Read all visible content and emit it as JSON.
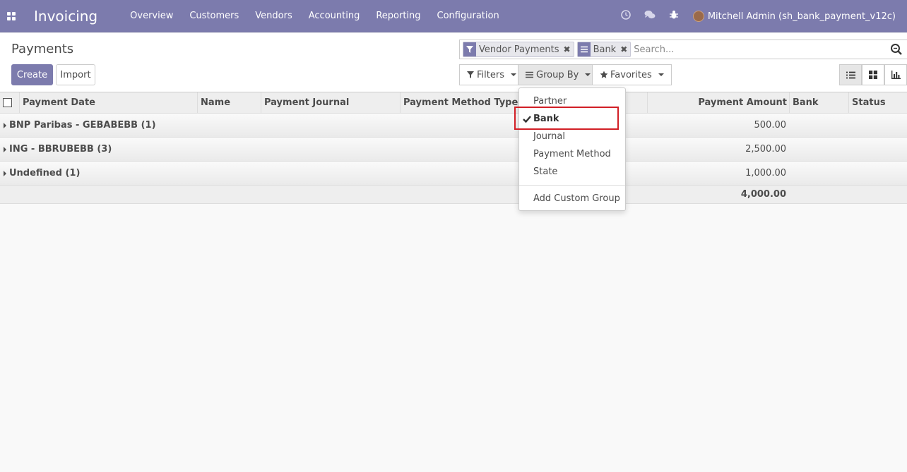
{
  "navbar": {
    "brand": "Invoicing",
    "menu": [
      "Overview",
      "Customers",
      "Vendors",
      "Accounting",
      "Reporting",
      "Configuration"
    ],
    "user": "Mitchell Admin (sh_bank_payment_v12c)",
    "icons": [
      "clock-icon",
      "chat-icon",
      "bug-icon"
    ]
  },
  "control_panel": {
    "breadcrumb": "Payments",
    "create_label": "Create",
    "import_label": "Import",
    "facets": [
      {
        "icon": "filter-icon",
        "label": "Vendor Payments"
      },
      {
        "icon": "groupby-icon",
        "label": "Bank"
      }
    ],
    "search_placeholder": "Search...",
    "filters_label": "Filters",
    "groupby_label": "Group By",
    "favorites_label": "Favorites"
  },
  "table": {
    "columns": [
      "Payment Date",
      "Name",
      "Payment Journal",
      "Payment Method Type",
      "Payment Amount",
      "Bank",
      "Status"
    ],
    "groups": [
      {
        "title": "BNP Paribas - GEBABEBB (1)",
        "amount": "500.00"
      },
      {
        "title": "ING - BBRUBEBB (3)",
        "amount": "2,500.00"
      },
      {
        "title": "Undefined (1)",
        "amount": "1,000.00"
      }
    ],
    "total": "4,000.00"
  },
  "groupby_menu": {
    "items": [
      {
        "label": "Partner",
        "selected": false
      },
      {
        "label": "Bank",
        "selected": true
      },
      {
        "label": "Journal",
        "selected": false
      },
      {
        "label": "Payment Method",
        "selected": false
      },
      {
        "label": "State",
        "selected": false
      }
    ],
    "custom_group": "Add Custom Group"
  },
  "colors": {
    "brand": "#7c7bad",
    "highlight": "#d21f26"
  }
}
